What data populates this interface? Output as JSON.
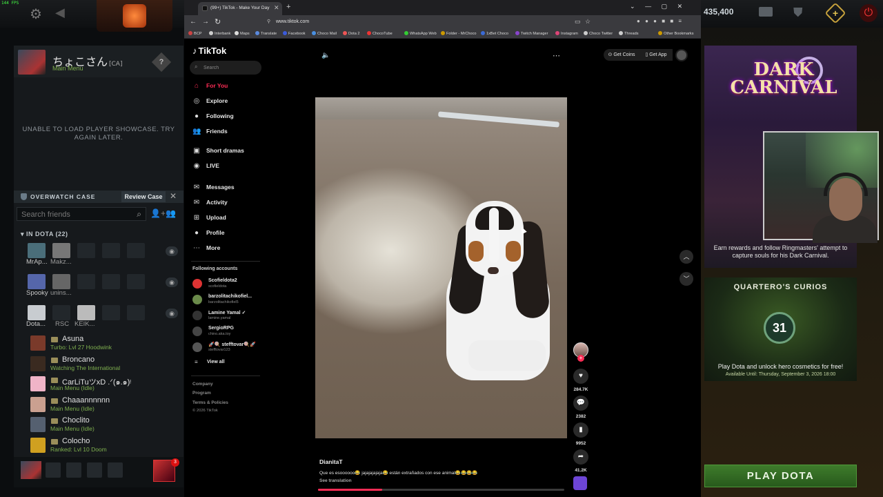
{
  "dota": {
    "fps": "144 FPS",
    "shards": "435,400",
    "profile": {
      "name": "ちょこさん",
      "tag": "[CA]",
      "status": "Main Menu"
    },
    "showcase_error": "UNABLE TO LOAD PLAYER SHOWCASE. TRY AGAIN LATER.",
    "overwatch": {
      "title": "OVERWATCH CASE",
      "review_label": "Review Case"
    },
    "friends_search_placeholder": "Search friends",
    "in_dota_header": "IN DOTA (22)",
    "party_rows": [
      {
        "a": "MrAp...",
        "b": "Makz..."
      },
      {
        "a": "Spooky",
        "b": "unins..."
      },
      {
        "a": "Dota...",
        "b": "RSC",
        "c": "KEIK..."
      }
    ],
    "friends": [
      {
        "name": "Asuna",
        "status": "Turbo: Lvl 27 Hoodwink",
        "color": "#7a3a2a",
        "grey": false
      },
      {
        "name": "Broncano",
        "status": "Watching The International",
        "color": "#3a2a20",
        "grey": false
      },
      {
        "name": "CarLiTuツxD .ᐟ(๑.๑)ᵎ",
        "status": "Main Menu (Idle)",
        "color": "#f0b4c8",
        "grey": false
      },
      {
        "name": "Chaaannnnnn",
        "status": "Main Menu (Idle)",
        "color": "#caa090",
        "grey": false
      },
      {
        "name": "Choclito",
        "status": "Main Menu (Idle)",
        "color": "#556070",
        "grey": false
      },
      {
        "name": "Colocho",
        "status": "Ranked: Lvl 10 Doom",
        "color": "#d0a020",
        "grey": false
      }
    ],
    "notif_count": "3",
    "carnival_logo": "DARK CARNIVAL",
    "carnival_text": "Earn rewards and follow Ringmasters' attempt to capture souls for his Dark Carnival.",
    "curios_title": "QUARTERO'S CURIOS",
    "curios_badge": "31",
    "curios_text": "Play Dota and unlock hero cosmetics for free!",
    "curios_date": "Available Until:  Thursday, September 3, 2026 18:00",
    "play_label": "PLAY DOTA"
  },
  "browser": {
    "tab_title": "(99+) TikTok - Make Your Day",
    "url": "www.tiktok.com",
    "bookmarks": [
      "BCP",
      "Interbank",
      "Maps",
      "Translate",
      "Facebook",
      "Choco Mail",
      "Dota 2",
      "ChocoTube",
      "WhatsApp Web",
      "Folder - MrChoco",
      "1xBet Choco",
      "Twitch Manager",
      "Instagram",
      "Choco Twitter",
      "Threads",
      "Other Bookmarks"
    ]
  },
  "tiktok": {
    "logo": "TikTok",
    "search_placeholder": "Search",
    "nav": [
      {
        "label": "For You",
        "icon": "home-icon",
        "glyph": "⌂"
      },
      {
        "label": "Explore",
        "icon": "compass-icon",
        "glyph": "◎"
      },
      {
        "label": "Following",
        "icon": "following-icon",
        "glyph": "●"
      },
      {
        "label": "Friends",
        "icon": "friends-icon",
        "glyph": "👥"
      },
      {
        "label": "Short dramas",
        "icon": "dramas-icon",
        "glyph": "▣"
      },
      {
        "label": "LIVE",
        "icon": "live-icon",
        "glyph": "◉"
      },
      {
        "label": "Messages",
        "icon": "messages-icon",
        "glyph": "✉"
      },
      {
        "label": "Activity",
        "icon": "activity-icon",
        "glyph": "✉"
      },
      {
        "label": "Upload",
        "icon": "upload-icon",
        "glyph": "⊞"
      },
      {
        "label": "Profile",
        "icon": "profile-icon",
        "glyph": "●"
      },
      {
        "label": "More",
        "icon": "more-icon",
        "glyph": "⋯"
      }
    ],
    "following_header": "Following accounts",
    "accounts": [
      {
        "name": "Scofieldota2",
        "handle": "scofieldota",
        "color": "#d33"
      },
      {
        "name": "barzolitachikofiel...",
        "handle": "barzolitachikofiel5",
        "color": "#6a8a4a"
      },
      {
        "name": "Lamine Yamal ✓",
        "handle": "lamine.yamal",
        "color": "#333"
      },
      {
        "name": "SergioRPG",
        "handle": "chino.aka.toy",
        "color": "#444"
      },
      {
        "name": "🚀🍭 stefftovar🍭🚀",
        "handle": "stefftovar123",
        "color": "#555"
      }
    ],
    "view_all": "View all",
    "footer": [
      "Company",
      "Program",
      "Terms & Policies",
      "© 2026 TikTok"
    ],
    "get_coins": "Get Coins",
    "get_app": "Get App",
    "likes": "284.7K",
    "comments": "2382",
    "saves": "9952",
    "shares": "41.2K",
    "caption_user": "DianitaT",
    "caption_text": "Que es esoooooo😂 jajajajajaja😂 están extrañados con ese animal😂😂😂😂",
    "see_translation": "See translation",
    "progress": 0.26
  }
}
